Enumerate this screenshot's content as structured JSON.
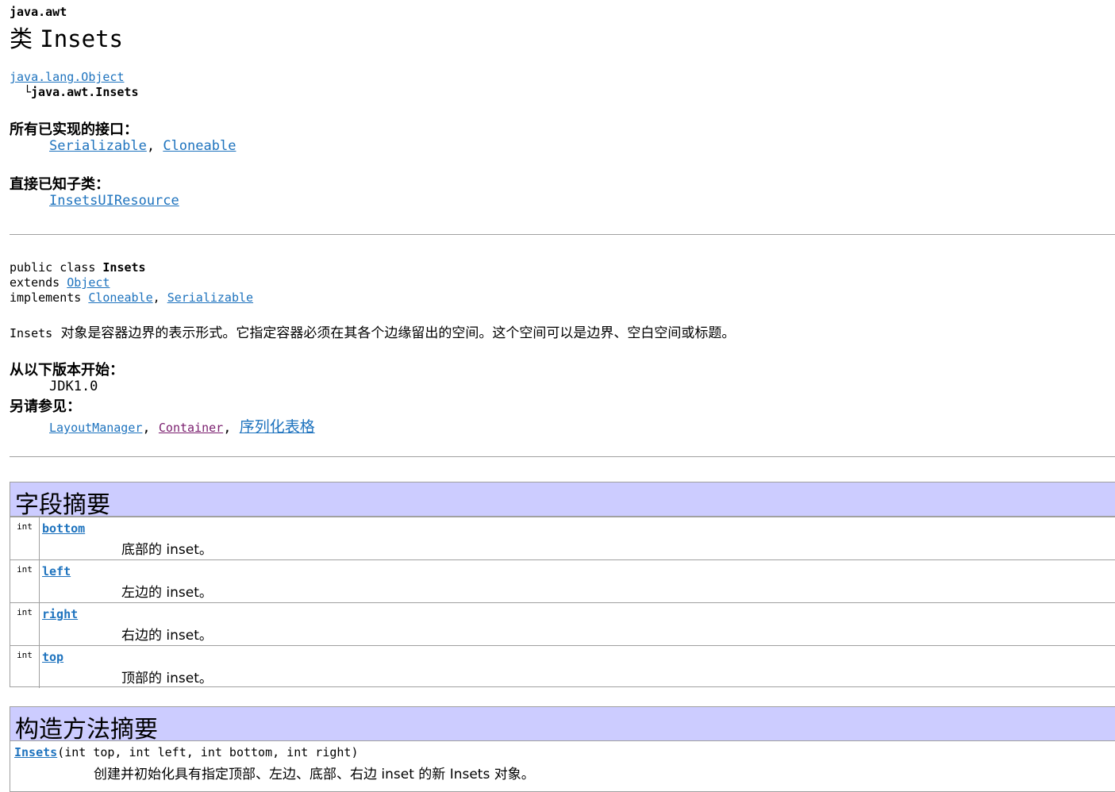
{
  "header": {
    "package": "java.awt",
    "title_prefix": "类",
    "class_name": "Insets"
  },
  "hierarchy": {
    "parent": "java.lang.Object",
    "connector": "└",
    "child": "java.awt.Insets"
  },
  "interfaces": {
    "label": "所有已实现的接口：",
    "items": [
      "Serializable",
      "Cloneable"
    ],
    "separator": ","
  },
  "subclasses": {
    "label": "直接已知子类：",
    "items": [
      "InsetsUIResource"
    ]
  },
  "declaration": {
    "line1_prefix": "public class ",
    "line1_name": "Insets",
    "line2_prefix": "extends ",
    "line2_link": "Object",
    "line3_prefix": "implements ",
    "line3_links": [
      "Cloneable",
      "Serializable"
    ]
  },
  "description": {
    "code": "Insets",
    "text": "对象是容器边界的表示形式。它指定容器必须在其各个边缘留出的空间。这个空间可以是边界、空白空间或标题。"
  },
  "since": {
    "label": "从以下版本开始：",
    "value": "JDK1.0"
  },
  "see_also": {
    "label": "另请参见：",
    "items": [
      "LayoutManager",
      "Container",
      "序列化表格"
    ]
  },
  "field_summary": {
    "title": "字段摘要",
    "rows": [
      {
        "type": "int",
        "name": "bottom",
        "desc": "底部的 inset。"
      },
      {
        "type": "int",
        "name": "left",
        "desc": "左边的 inset。"
      },
      {
        "type": "int",
        "name": "right",
        "desc": "右边的 inset。"
      },
      {
        "type": "int",
        "name": "top",
        "desc": "顶部的 inset。"
      }
    ]
  },
  "constructor_summary": {
    "title": "构造方法摘要",
    "name": "Insets",
    "params": "(int top, int left, int bottom, int right)",
    "desc": "创建并初始化具有指定顶部、左边、底部、右边 inset 的新 Insets 对象。"
  }
}
